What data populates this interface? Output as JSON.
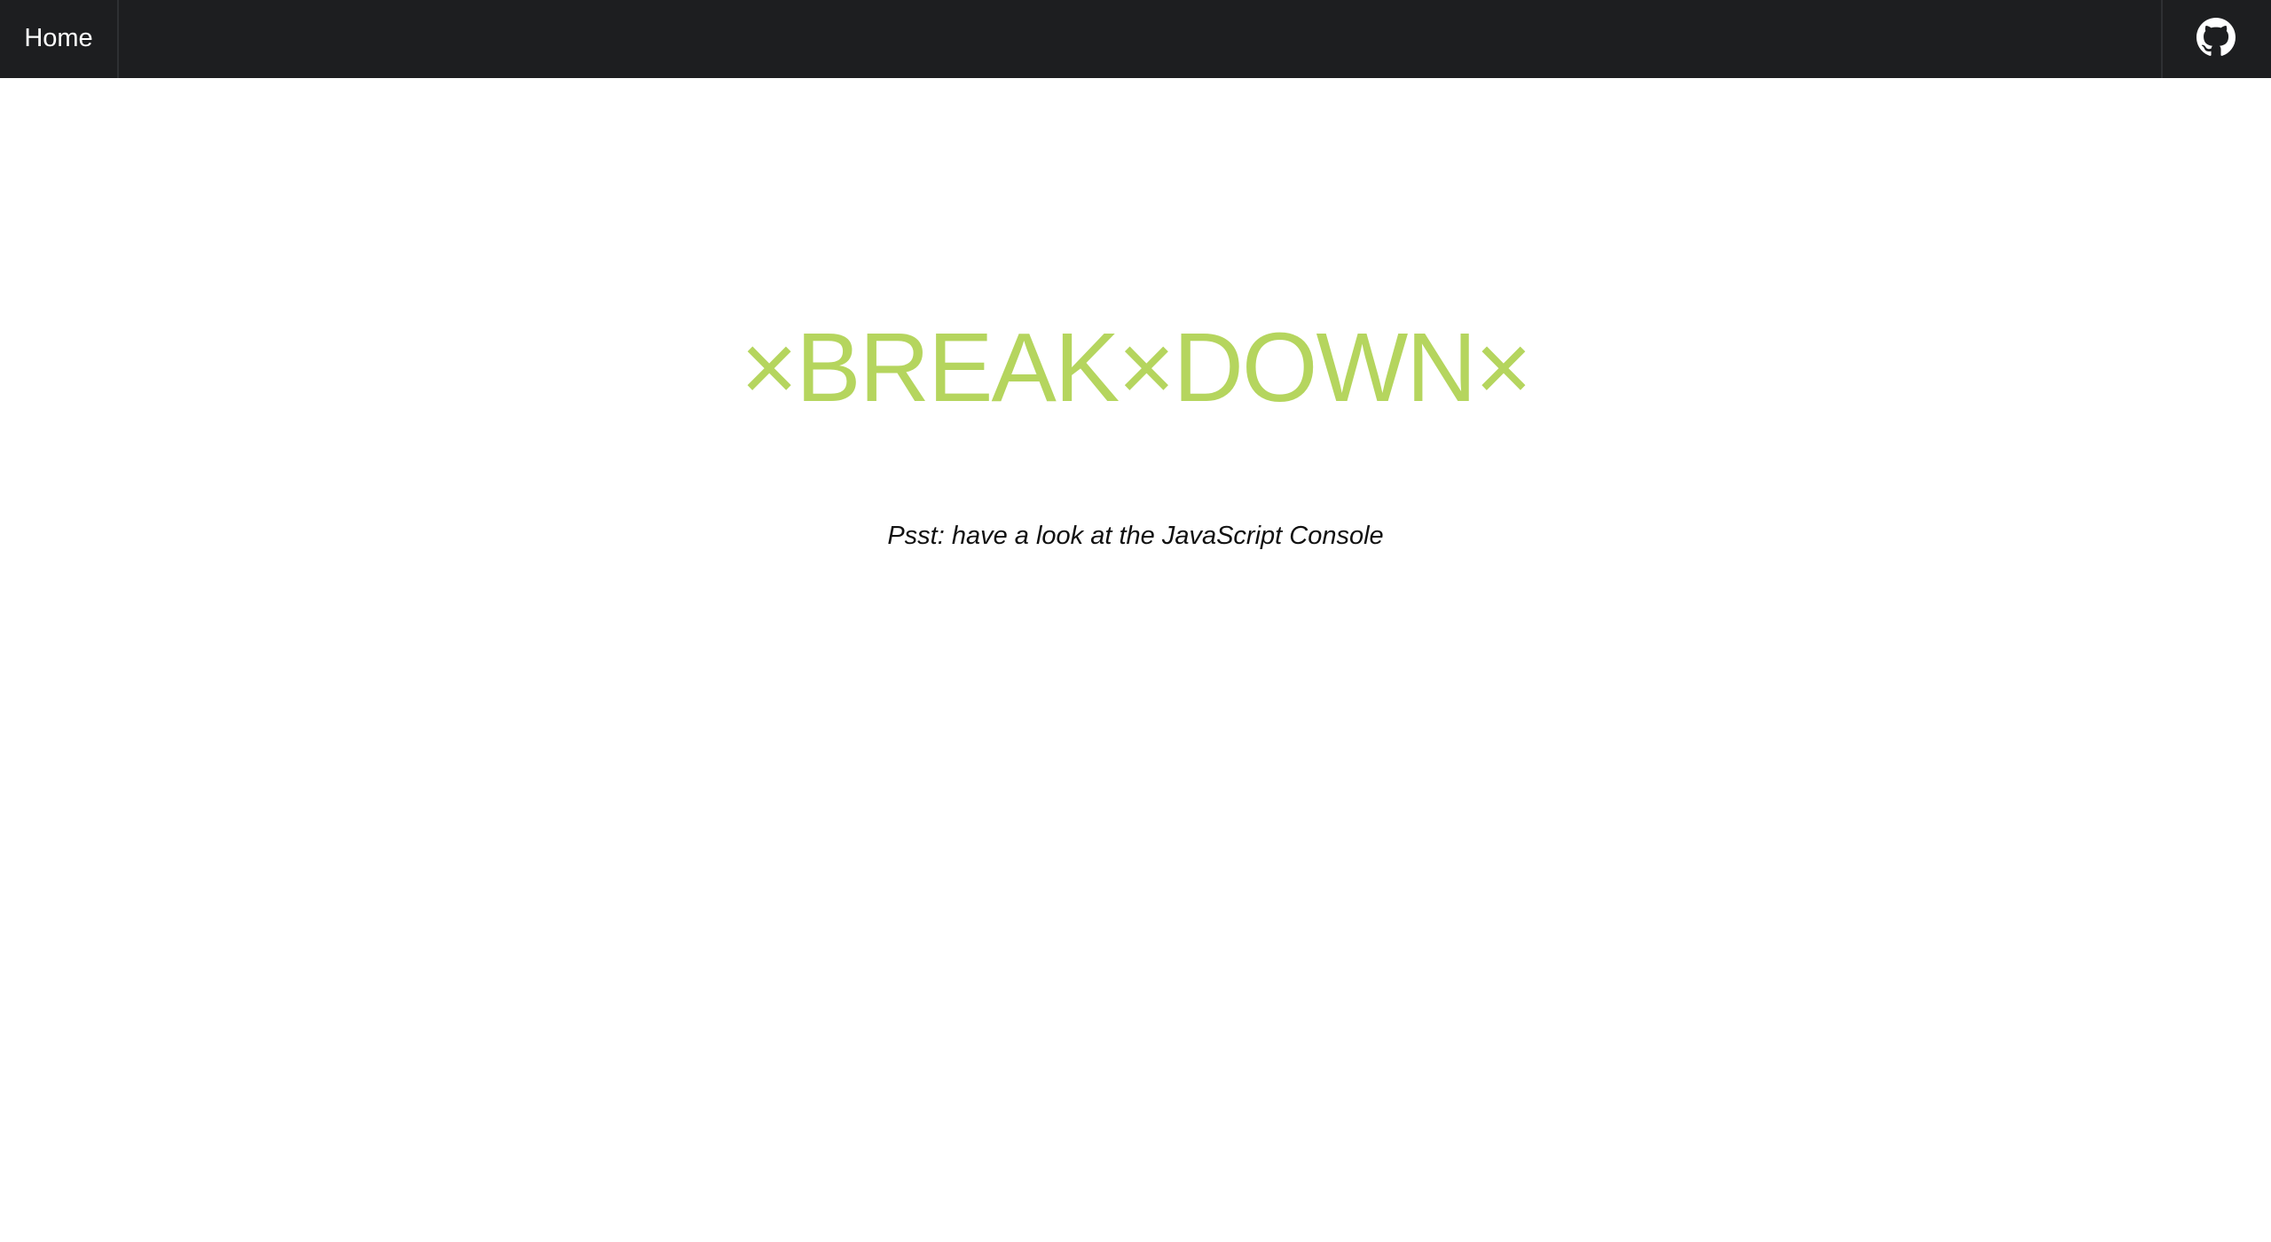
{
  "nav": {
    "home_label": "Home",
    "github_icon": "github-icon"
  },
  "hero": {
    "title_parts": [
      "×",
      "BREAK",
      "×",
      "DOWN",
      "×"
    ],
    "title_color": "#b5d55e",
    "subtitle": "Psst: have a look at the JavaScript Console"
  },
  "colors": {
    "navbar_bg": "#1d1e20",
    "nav_text": "#ffffff",
    "page_bg": "#ffffff"
  }
}
